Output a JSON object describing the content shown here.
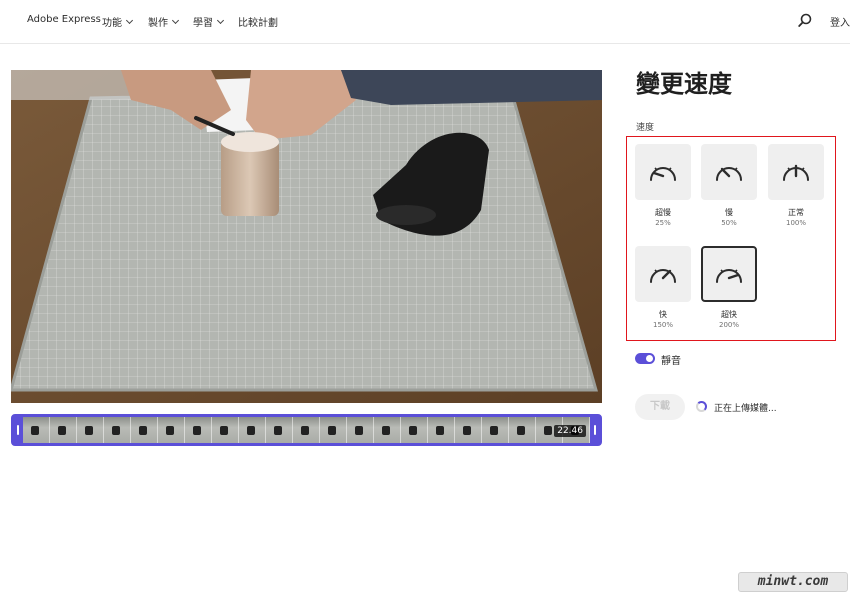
{
  "nav": {
    "brand": "Adobe Express",
    "items": [
      {
        "label": "功能",
        "has_caret": true
      },
      {
        "label": "製作",
        "has_caret": true
      },
      {
        "label": "學習",
        "has_caret": true
      },
      {
        "label": "比較計劃",
        "has_caret": false
      }
    ],
    "search_icon": "search-icon",
    "signin": "登入"
  },
  "timeline": {
    "duration": "22.46",
    "accent": "#5b4fd8"
  },
  "panel": {
    "title": "變更速度",
    "speed_label": "速度",
    "options": [
      {
        "name": "超慢",
        "value": "25%",
        "icon": "gauge-very-slow-icon",
        "selected": false
      },
      {
        "name": "慢",
        "value": "50%",
        "icon": "gauge-slow-icon",
        "selected": false
      },
      {
        "name": "正常",
        "value": "100%",
        "icon": "gauge-normal-icon",
        "selected": false
      },
      {
        "name": "快",
        "value": "150%",
        "icon": "gauge-fast-icon",
        "selected": false
      },
      {
        "name": "超快",
        "value": "200%",
        "icon": "gauge-very-fast-icon",
        "selected": true
      }
    ],
    "mute": {
      "label": "靜音",
      "on": true
    },
    "download_label": "下載",
    "upload_status": "正在上傳媒體..."
  },
  "colors": {
    "accent": "#5b4fd8",
    "highlight_border": "#e0161d"
  },
  "watermark": "minwt.com"
}
